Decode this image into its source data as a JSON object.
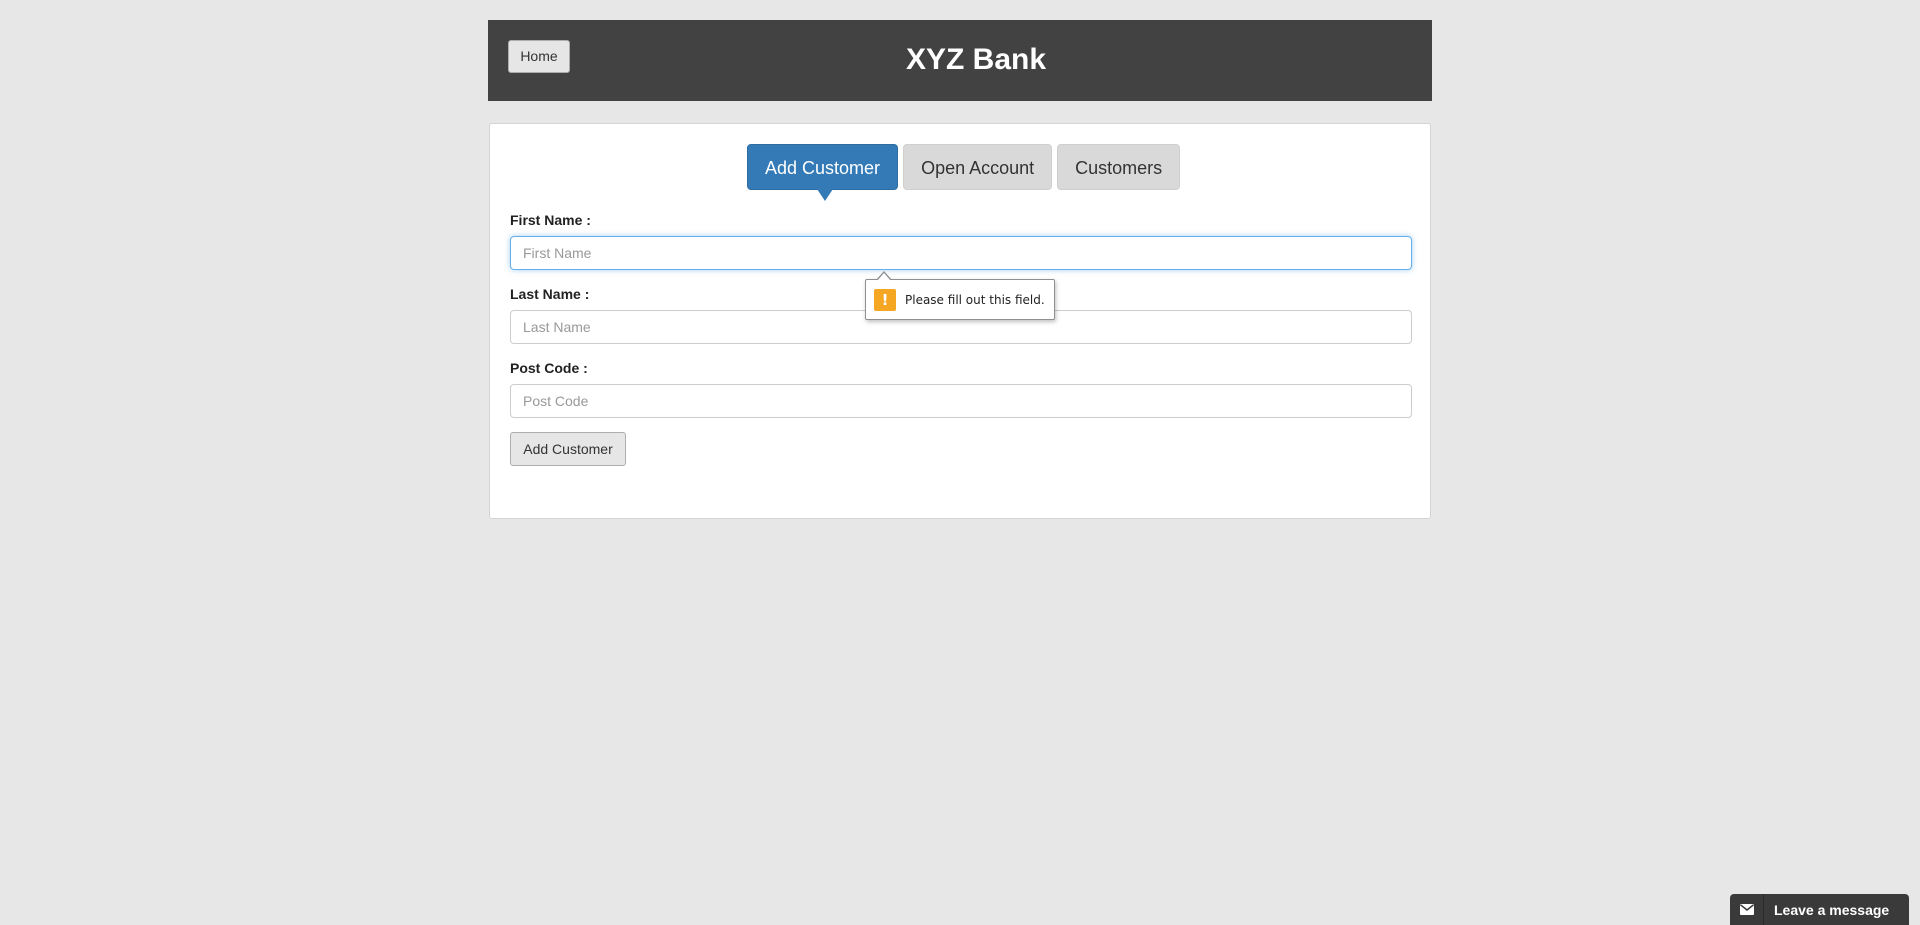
{
  "header": {
    "home_label": "Home",
    "title": "XYZ Bank"
  },
  "tabs": [
    {
      "label": "Add Customer",
      "active": true
    },
    {
      "label": "Open Account",
      "active": false
    },
    {
      "label": "Customers",
      "active": false
    }
  ],
  "form": {
    "first_name": {
      "label": "First Name :",
      "placeholder": "First Name",
      "value": ""
    },
    "last_name": {
      "label": "Last Name :",
      "placeholder": "Last Name",
      "value": ""
    },
    "post_code": {
      "label": "Post Code :",
      "placeholder": "Post Code",
      "value": ""
    },
    "submit_label": "Add Customer"
  },
  "validation": {
    "message": "Please fill out this field.",
    "icon": "exclamation-warning-icon",
    "icon_glyph": "!",
    "icon_color": "#f5a623"
  },
  "chat": {
    "label": "Leave a message",
    "icon": "envelope-icon"
  },
  "colors": {
    "header_bg": "#424242",
    "active_tab": "#337ab7",
    "page_bg": "#e7e7e7"
  }
}
